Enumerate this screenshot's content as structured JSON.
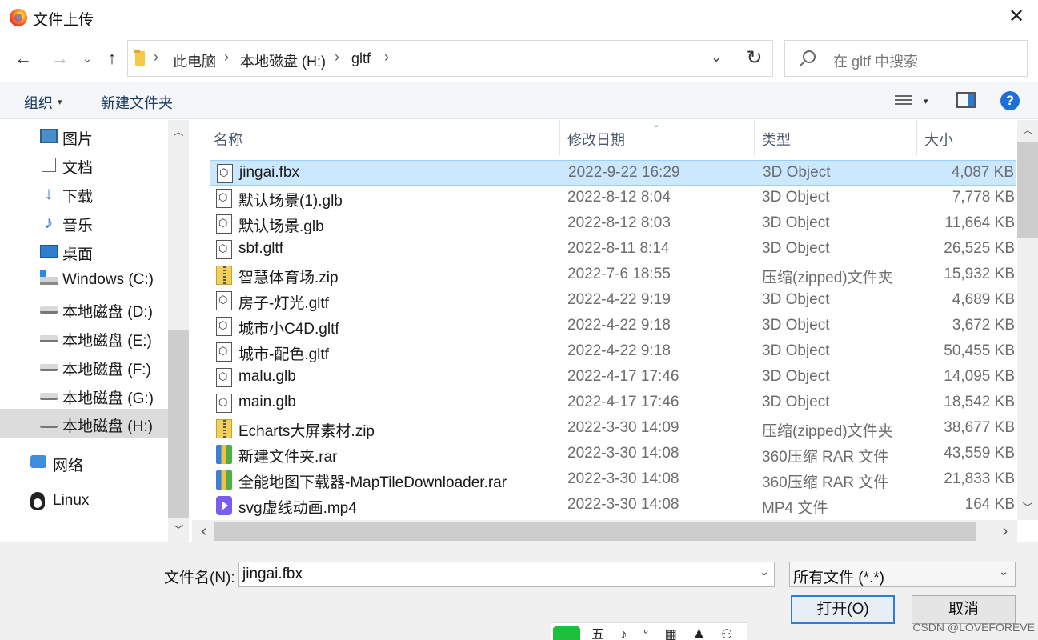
{
  "window": {
    "title": "文件上传",
    "close": "✕"
  },
  "nav": {
    "back": "←",
    "forward": "→",
    "recent": "⌄",
    "up": "↑"
  },
  "breadcrumb": {
    "items": [
      "此电脑",
      "本地磁盘 (H:)",
      "gltf"
    ],
    "sep": "›",
    "dropdown": "⌄",
    "refresh": "↻"
  },
  "search": {
    "placeholder": "在 gltf 中搜索"
  },
  "toolbar": {
    "organize": "组织",
    "caret": "▾",
    "new_folder": "新建文件夹",
    "help": "?"
  },
  "sidebar": {
    "items": [
      {
        "label": "图片"
      },
      {
        "label": "文档"
      },
      {
        "label": "下载"
      },
      {
        "label": "音乐"
      },
      {
        "label": "桌面"
      },
      {
        "label": "Windows (C:)"
      },
      {
        "label": "本地磁盘 (D:)"
      },
      {
        "label": "本地磁盘 (E:)"
      },
      {
        "label": "本地磁盘 (F:)"
      },
      {
        "label": "本地磁盘 (G:)"
      },
      {
        "label": "本地磁盘 (H:)",
        "selected": true
      },
      {
        "label": "网络"
      },
      {
        "label": "Linux"
      }
    ]
  },
  "columns": {
    "name": "名称",
    "date": "修改日期",
    "type": "类型",
    "size": "大小",
    "sort_caret": "⌄"
  },
  "files": [
    {
      "name": "jingai.fbx",
      "date": "2022-9-22 16:29",
      "type": "3D Object",
      "size": "4,087 KB",
      "icon": "3d-object-icon",
      "selected": true
    },
    {
      "name": "默认场景(1).glb",
      "date": "2022-8-12 8:04",
      "type": "3D Object",
      "size": "7,778 KB",
      "icon": "3d-object-icon"
    },
    {
      "name": "默认场景.glb",
      "date": "2022-8-12 8:03",
      "type": "3D Object",
      "size": "11,664 KB",
      "icon": "3d-object-icon"
    },
    {
      "name": "sbf.gltf",
      "date": "2022-8-11 8:14",
      "type": "3D Object",
      "size": "26,525 KB",
      "icon": "3d-object-icon"
    },
    {
      "name": "智慧体育场.zip",
      "date": "2022-7-6 18:55",
      "type": "压缩(zipped)文件夹",
      "size": "15,932 KB",
      "icon": "zip-folder-icon"
    },
    {
      "name": "房子-灯光.gltf",
      "date": "2022-4-22 9:19",
      "type": "3D Object",
      "size": "4,689 KB",
      "icon": "3d-object-icon"
    },
    {
      "name": "城市小C4D.gltf",
      "date": "2022-4-22 9:18",
      "type": "3D Object",
      "size": "3,672 KB",
      "icon": "3d-object-icon"
    },
    {
      "name": "城市-配色.gltf",
      "date": "2022-4-22 9:18",
      "type": "3D Object",
      "size": "50,455 KB",
      "icon": "3d-object-icon"
    },
    {
      "name": "malu.glb",
      "date": "2022-4-17 17:46",
      "type": "3D Object",
      "size": "14,095 KB",
      "icon": "3d-object-icon"
    },
    {
      "name": "main.glb",
      "date": "2022-4-17 17:46",
      "type": "3D Object",
      "size": "18,542 KB",
      "icon": "3d-object-icon"
    },
    {
      "name": "Echarts大屏素材.zip",
      "date": "2022-3-30 14:09",
      "type": "压缩(zipped)文件夹",
      "size": "38,677 KB",
      "icon": "zip-folder-icon"
    },
    {
      "name": "新建文件夹.rar",
      "date": "2022-3-30 14:08",
      "type": "360压缩 RAR 文件",
      "size": "43,559 KB",
      "icon": "rar-archive-icon"
    },
    {
      "name": "全能地图下载器-MapTileDownloader.rar",
      "date": "2022-3-30 14:08",
      "type": "360压缩 RAR 文件",
      "size": "21,833 KB",
      "icon": "rar-archive-icon"
    },
    {
      "name": "svg虚线动画.mp4",
      "date": "2022-3-30 14:08",
      "type": "MP4 文件",
      "size": "164 KB",
      "icon": "video-file-icon"
    }
  ],
  "scroll": {
    "up": "︿",
    "down": "﹀",
    "left": "‹",
    "right": "›"
  },
  "footer": {
    "filename_label": "文件名(N):",
    "filename_value": "jingai.fbx",
    "filetype_value": "所有文件 (*.*)",
    "dropdown": "⌄",
    "open": "打开(O)",
    "cancel": "取消",
    "watermark": "CSDN @LOVEFOREVE",
    "ime": "五 ♪ ° ▦ ♟ ⚇"
  }
}
